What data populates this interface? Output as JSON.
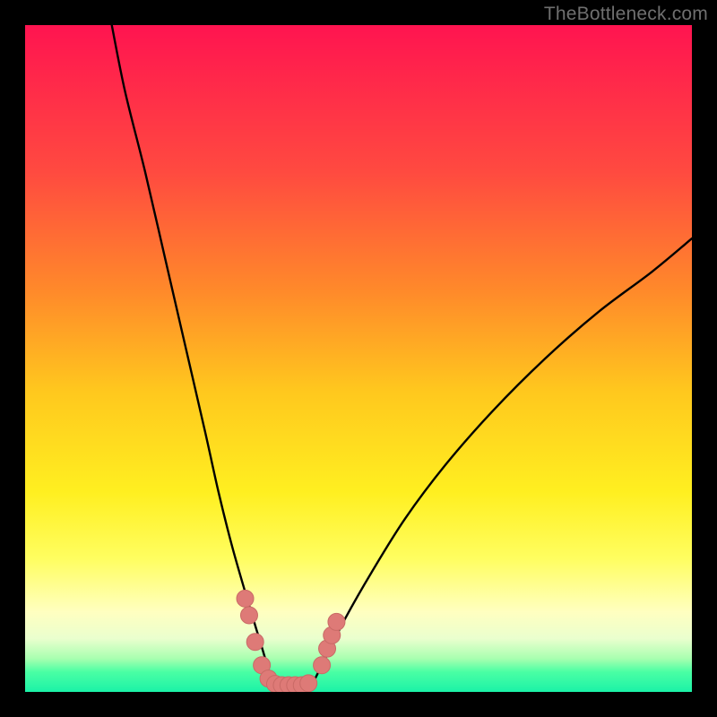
{
  "watermark": "TheBottleneck.com",
  "colors": {
    "frame": "#000000",
    "curve": "#000000",
    "marker_fill": "#de7a77",
    "marker_stroke": "#c96a66",
    "gradient_stops": [
      "#ff1450",
      "#ff4a40",
      "#ff8a2a",
      "#ffc81e",
      "#ffef20",
      "#fffe60",
      "#ffffc0",
      "#eaffce",
      "#a8ffb0",
      "#4affa4",
      "#1bf2a7"
    ]
  },
  "chart_data": {
    "type": "line",
    "title": "",
    "xlabel": "",
    "ylabel": "",
    "xlim": [
      0,
      100
    ],
    "ylim": [
      0,
      100
    ],
    "series": [
      {
        "name": "bottleneck-curve-left",
        "x": [
          13,
          15,
          18,
          21,
          24,
          27,
          29,
          31,
          33,
          34.5,
          36,
          37
        ],
        "y": [
          100,
          90,
          78,
          65,
          52,
          39,
          30,
          22,
          15,
          10,
          5,
          1
        ]
      },
      {
        "name": "bottleneck-curve-right",
        "x": [
          43,
          45,
          48,
          52,
          57,
          63,
          70,
          78,
          86,
          94,
          100
        ],
        "y": [
          1,
          5,
          11,
          18,
          26,
          34,
          42,
          50,
          57,
          63,
          68
        ]
      }
    ],
    "markers": {
      "name": "highlighted-points",
      "points": [
        {
          "x": 33.0,
          "y": 14.0
        },
        {
          "x": 33.6,
          "y": 11.5
        },
        {
          "x": 34.5,
          "y": 7.5
        },
        {
          "x": 35.5,
          "y": 4.0
        },
        {
          "x": 36.5,
          "y": 2.0
        },
        {
          "x": 37.5,
          "y": 1.2
        },
        {
          "x": 38.5,
          "y": 1.0
        },
        {
          "x": 39.5,
          "y": 1.0
        },
        {
          "x": 40.5,
          "y": 1.0
        },
        {
          "x": 41.5,
          "y": 1.0
        },
        {
          "x": 42.5,
          "y": 1.3
        },
        {
          "x": 44.5,
          "y": 4.0
        },
        {
          "x": 45.3,
          "y": 6.5
        },
        {
          "x": 46.0,
          "y": 8.5
        },
        {
          "x": 46.7,
          "y": 10.5
        }
      ]
    }
  }
}
